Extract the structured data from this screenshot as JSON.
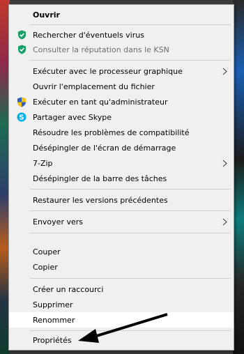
{
  "menu": {
    "items": [
      {
        "label": "Ouvrir"
      },
      {
        "label": "Rechercher d'éventuels virus"
      },
      {
        "label": "Consulter la réputation dans le KSN"
      },
      {
        "label": "Exécuter avec le processeur graphique"
      },
      {
        "label": "Ouvrir l'emplacement du fichier"
      },
      {
        "label": "Exécuter en tant qu'administrateur"
      },
      {
        "label": "Partager avec Skype"
      },
      {
        "label": "Résoudre les problèmes de compatibilité"
      },
      {
        "label": "Désépingler de l'écran de démarrage"
      },
      {
        "label": "7-Zip"
      },
      {
        "label": "Désépingler de la barre des tâches"
      },
      {
        "label": "Restaurer les versions précédentes"
      },
      {
        "label": "Envoyer vers"
      },
      {
        "label": "Couper"
      },
      {
        "label": "Copier"
      },
      {
        "label": "Créer un raccourci"
      },
      {
        "label": "Supprimer"
      },
      {
        "label": "Renommer"
      },
      {
        "label": "Propriétés"
      }
    ]
  },
  "icons": {
    "kaspersky_scan": "kaspersky-shield-icon",
    "kaspersky_ksn": "kaspersky-shield-icon",
    "uac": "uac-shield-icon",
    "skype": "skype-icon",
    "submenu": "chevron-right-icon"
  },
  "colors": {
    "kaspersky_green": "#1a9e6a",
    "skype_blue": "#00aff0",
    "menu_bg": "#f0f0f0",
    "highlight": "#ffffff"
  }
}
